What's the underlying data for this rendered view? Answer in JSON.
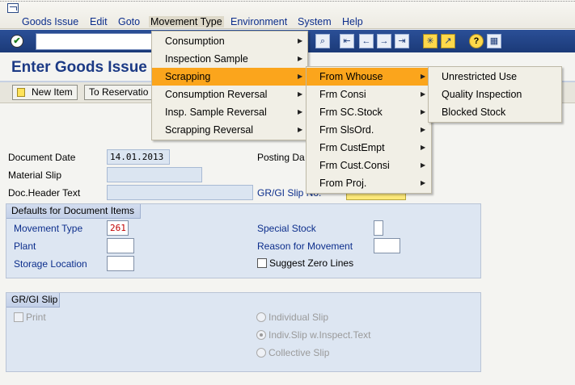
{
  "menubar": [
    "Goods Issue",
    "Edit",
    "Goto",
    "Movement Type",
    "Environment",
    "System",
    "Help"
  ],
  "title": "Enter Goods Issue",
  "app_toolbar": {
    "new_item": "New Item",
    "to_reservation": "To Reservatio"
  },
  "fields": {
    "document_date_label": "Document Date",
    "document_date": "14.01.2013",
    "material_slip_label": "Material Slip",
    "doc_header_label": "Doc.Header Text",
    "posting_date_label": "Posting Da",
    "grgi_slip_no_label": "GR/GI Slip No."
  },
  "defaults_group": {
    "caption": "Defaults for Document Items",
    "movement_type_label": "Movement Type",
    "movement_type": "261",
    "plant_label": "Plant",
    "storage_location_label": "Storage Location",
    "special_stock_label": "Special Stock",
    "reason_label": "Reason for Movement",
    "suggest_zero_label": "Suggest Zero Lines"
  },
  "slip_group": {
    "caption": "GR/GI Slip",
    "print_label": "Print",
    "individual_slip": "Individual Slip",
    "indiv_inspect": "Indiv.Slip w.Inspect.Text",
    "collective_slip": "Collective Slip"
  },
  "movement_menu": [
    "Consumption",
    "Inspection Sample",
    "Scrapping",
    "Consumption Reversal",
    "Insp. Sample Reversal",
    "Scrapping Reversal"
  ],
  "scrapping_menu": [
    "From Whouse",
    "Frm Consi",
    "Frm SC.Stock",
    "Frm SlsOrd.",
    "Frm CustEmpt",
    "Frm Cust.Consi",
    "From Proj."
  ],
  "whouse_menu": [
    "Unrestricted Use",
    "Quality Inspection",
    "Blocked Stock"
  ],
  "colors": {
    "menu_highlight": "#fba51c",
    "toolbar": "#1b3a78",
    "title": "#1c3a85",
    "movement_value": "#c00000"
  }
}
